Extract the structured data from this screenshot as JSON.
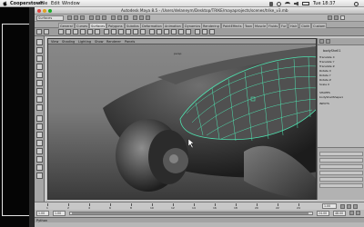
{
  "menubar": {
    "app_name": "Cooperstown",
    "items": [
      "File",
      "Edit",
      "Window"
    ],
    "clock": "Tue 18:37"
  },
  "window": {
    "title": "Autodesk Maya 8.5 - /Users/delaneym/Desktop/TRIKE/mayaprojects/scenes/trike_v3.mb"
  },
  "mode_menu": {
    "value": "Surfaces"
  },
  "shelf_tabs": [
    "General",
    "Curves",
    "Surfaces",
    "Polygons",
    "Subdivs",
    "Deformation",
    "Animation",
    "Dynamics",
    "Rendering",
    "PaintEffects",
    "Toon",
    "Muscle",
    "Fluids",
    "Fur",
    "Hair",
    "Cloth",
    "Custom"
  ],
  "viewport": {
    "menus": [
      "View",
      "Shading",
      "Lighting",
      "Show",
      "Renderer",
      "Panels"
    ],
    "camera_label": "persp"
  },
  "channel_box": {
    "object_name": "bodyShell1",
    "attributes": [
      "Translate X",
      "Translate Y",
      "Translate Z",
      "Rotate X",
      "Rotate Y",
      "Rotate Z",
      "Scale X"
    ],
    "shapes_label": "SHAPES",
    "shape_name": "bodyShellShape1",
    "inputs_label": "INPUTS"
  },
  "timeline": {
    "ticks": [
      "1",
      "2",
      "4",
      "6",
      "8",
      "10",
      "12",
      "14",
      "16",
      "18",
      "20",
      "22",
      "24"
    ],
    "current_frame": "1.00"
  },
  "range": {
    "start": "1.00",
    "range_start": "1.00",
    "range_end": "24.00",
    "end": "48.00"
  },
  "command_line": {
    "label": "Python"
  },
  "colors": {
    "wire": "#4fe3b0",
    "viewport_top": "#8a8a8a",
    "viewport_bottom": "#3a3a3a"
  }
}
